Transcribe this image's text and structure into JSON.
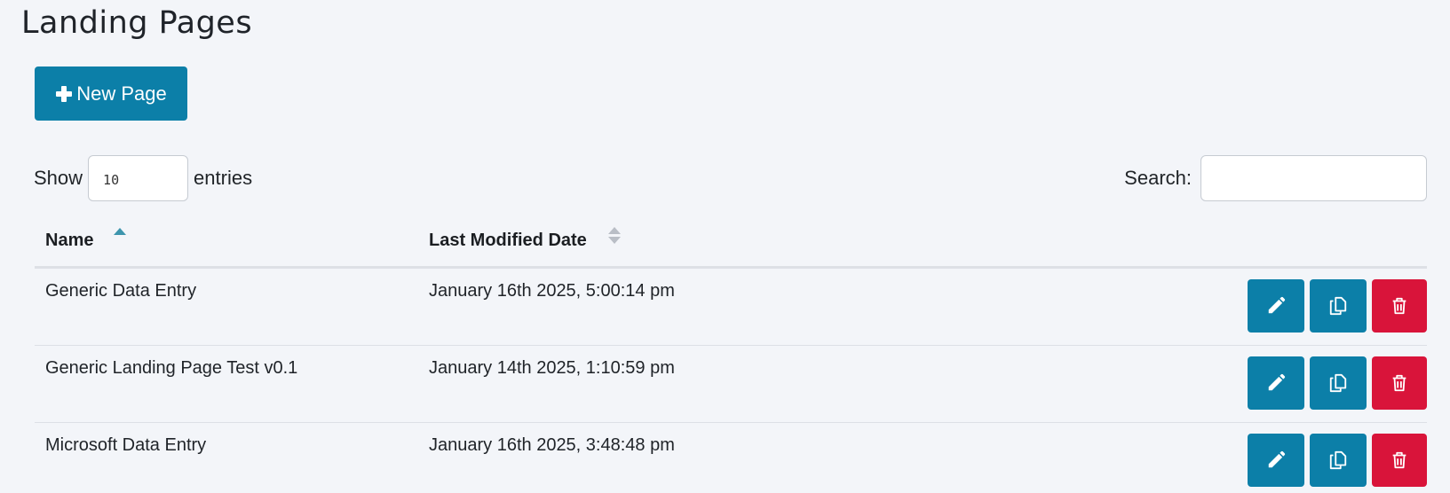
{
  "page": {
    "title": "Landing Pages"
  },
  "toolbar": {
    "new_page_label": "New Page"
  },
  "table_controls": {
    "show_label": "Show",
    "page_length": "10",
    "entries_label": "entries",
    "search_label": "Search:",
    "search_value": ""
  },
  "table": {
    "columns": [
      "Name",
      "Last Modified Date"
    ],
    "sort": {
      "column": "Name",
      "direction": "asc"
    },
    "rows": [
      {
        "name": "Generic Data Entry",
        "modified": "January 16th 2025, 5:00:14 pm"
      },
      {
        "name": "Generic Landing Page Test v0.1",
        "modified": "January 14th 2025, 1:10:59 pm"
      },
      {
        "name": "Microsoft Data Entry",
        "modified": "January 16th 2025, 3:48:48 pm"
      }
    ]
  },
  "row_actions": [
    "edit-icon",
    "copy-icon",
    "trash-icon"
  ],
  "colors": {
    "primary": "#0c7fa8",
    "danger": "#d9143a",
    "background": "#f3f5f9"
  }
}
